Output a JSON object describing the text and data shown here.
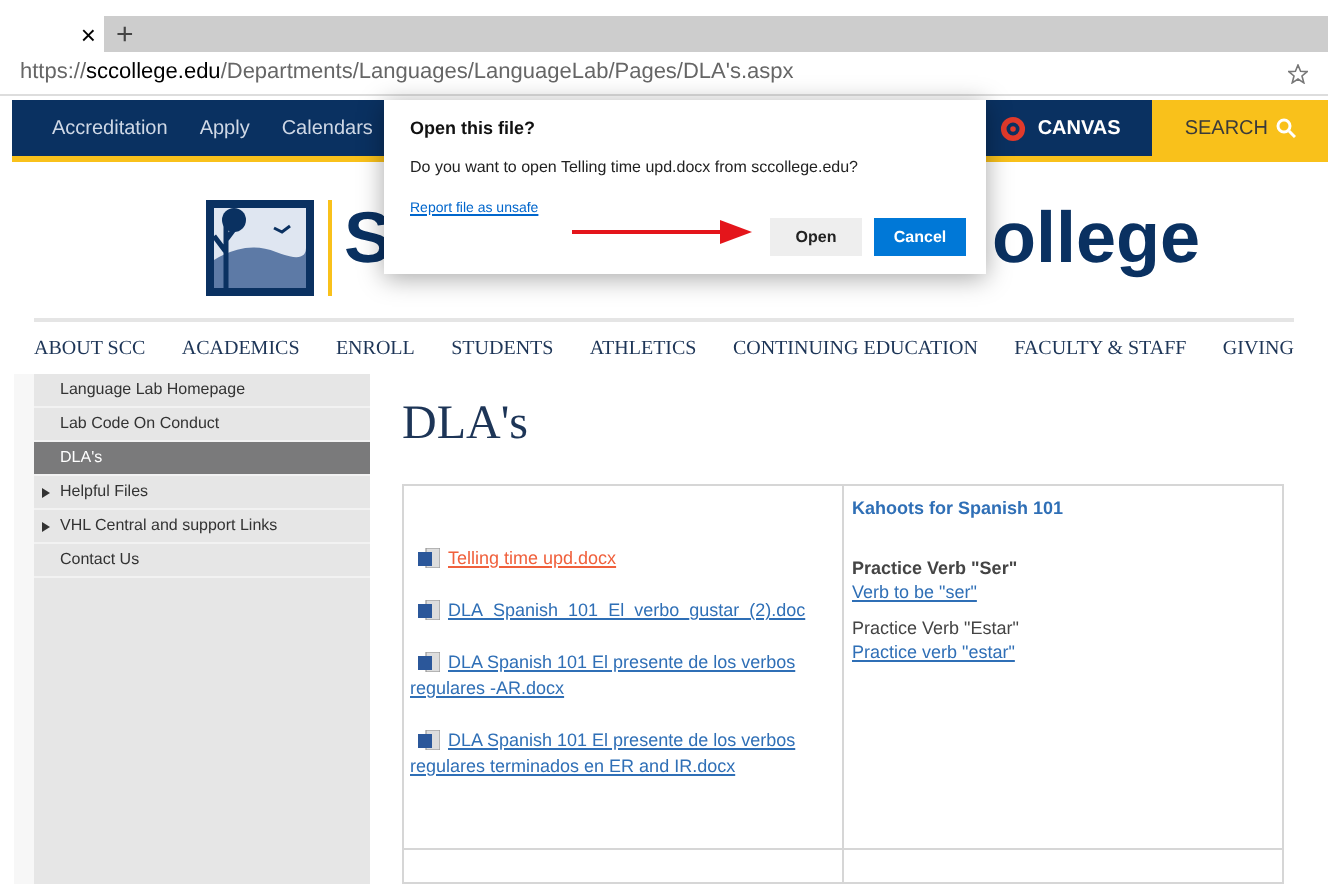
{
  "browser": {
    "tab_close": "×",
    "new_tab": "+",
    "url_prefix": "https://",
    "url_domain": "sccollege.edu",
    "url_path": "/Departments/Languages/LanguageLab/Pages/DLA's.aspx"
  },
  "top_nav": {
    "links": [
      "Accreditation",
      "Apply",
      "Calendars"
    ],
    "canvas": "CANVAS",
    "search": "SEARCH"
  },
  "dialog": {
    "title": "Open this file?",
    "message": "Do you want to open Telling time upd.docx from sccollege.edu?",
    "report_link": "Report file as unsafe",
    "buttons": [
      {
        "label": "Open",
        "kind": "secondary"
      },
      {
        "label": "Cancel",
        "kind": "primary"
      }
    ]
  },
  "logo": {
    "text_left": "S",
    "text_right": "ollege"
  },
  "main_nav": [
    "ABOUT SCC",
    "ACADEMICS",
    "ENROLL",
    "STUDENTS",
    "ATHLETICS",
    "CONTINUING EDUCATION",
    "FACULTY & STAFF",
    "GIVING"
  ],
  "sidebar": {
    "items": [
      {
        "label": "Language Lab Homepage",
        "selected": false,
        "expandable": false
      },
      {
        "label": "Lab Code On Conduct",
        "selected": false,
        "expandable": false
      },
      {
        "label": "DLA's",
        "selected": true,
        "expandable": false
      },
      {
        "label": "Helpful Files",
        "selected": false,
        "expandable": true
      },
      {
        "label": "VHL Central and support Links",
        "selected": false,
        "expandable": true
      },
      {
        "label": "Contact Us",
        "selected": false,
        "expandable": false
      }
    ]
  },
  "page_title": "DLA's",
  "table": {
    "files": [
      {
        "name": "Telling time upd.docx",
        "visited": true
      },
      {
        "name": "DLA_Spanish_101_El_verbo_gustar_(2).doc",
        "visited": false
      },
      {
        "name": "DLA Spanish 101 El presente de los verbos regulares -AR.docx",
        "visited": false
      },
      {
        "name": "DLA Spanish 101 El presente de los verbos regulares terminados en ER and IR.docx",
        "visited": false
      }
    ],
    "kahoots_heading": "Kahoots for Spanish 101",
    "kahoots": [
      {
        "label": "Practice Verb \"Ser\"",
        "bold": true,
        "link": "Verb to be \"ser\""
      },
      {
        "label": "Practice Verb \"Estar\"",
        "bold": false,
        "link": "Practice verb \"estar\""
      }
    ]
  }
}
